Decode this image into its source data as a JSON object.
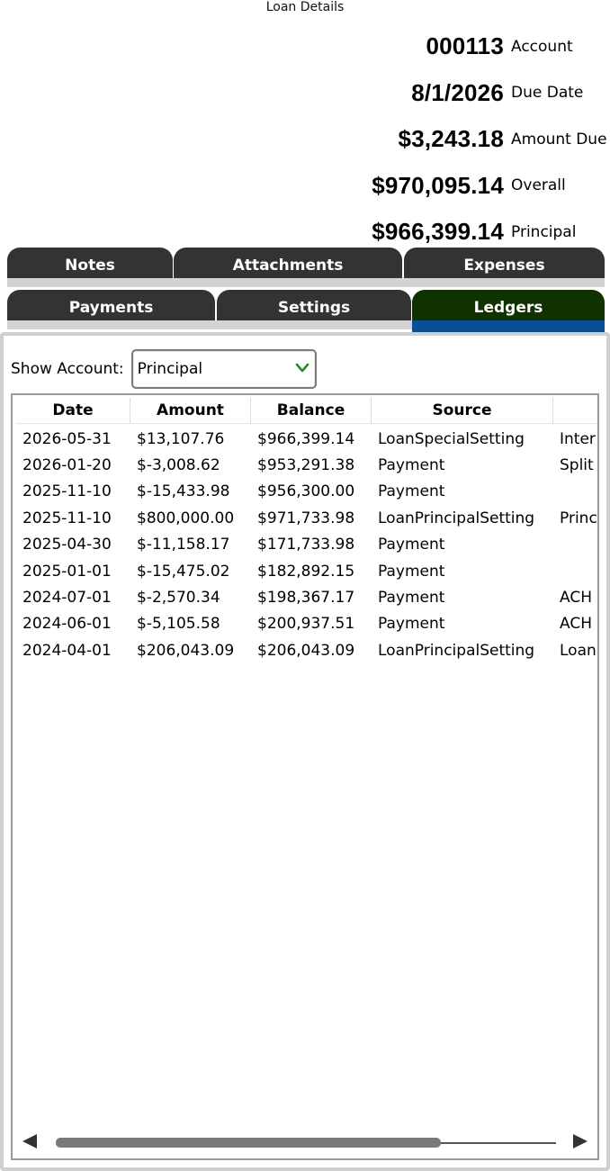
{
  "window": {
    "title": "Loan Details"
  },
  "summary": [
    {
      "value": "000113",
      "label": "Account"
    },
    {
      "value": "8/1/2026",
      "label": "Due Date"
    },
    {
      "value": "$3,243.18",
      "label": "Amount Due"
    },
    {
      "value": "$970,095.14",
      "label": "Overall"
    },
    {
      "value": "$966,399.14",
      "label": "Principal"
    }
  ],
  "tabs_top": [
    "Notes",
    "Attachments",
    "Expenses"
  ],
  "tabs_bottom": [
    "Payments",
    "Settings",
    "Ledgers"
  ],
  "active_tab": "Ledgers",
  "filter": {
    "label": "Show Account:",
    "selected": "Principal"
  },
  "table": {
    "columns": [
      "Date",
      "Amount",
      "Balance",
      "Source",
      ""
    ],
    "rows": [
      [
        "2026-05-31",
        "$13,107.76",
        "$966,399.14",
        "LoanSpecialSetting",
        "Inter"
      ],
      [
        "2026-01-20",
        "$-3,008.62",
        "$953,291.38",
        "Payment",
        "Split"
      ],
      [
        "2025-11-10",
        "$-15,433.98",
        "$956,300.00",
        "Payment",
        ""
      ],
      [
        "2025-11-10",
        "$800,000.00",
        "$971,733.98",
        "LoanPrincipalSetting",
        "Princ"
      ],
      [
        "2025-04-30",
        "$-11,158.17",
        "$171,733.98",
        "Payment",
        ""
      ],
      [
        "2025-01-01",
        "$-15,475.02",
        "$182,892.15",
        "Payment",
        ""
      ],
      [
        "2024-07-01",
        "$-2,570.34",
        "$198,367.17",
        "Payment",
        "ACH"
      ],
      [
        "2024-06-01",
        "$-5,105.58",
        "$200,937.51",
        "Payment",
        "ACH"
      ],
      [
        "2024-04-01",
        "$206,043.09",
        "$206,043.09",
        "LoanPrincipalSetting",
        "Loan"
      ]
    ]
  },
  "colors": {
    "tab_bg": "#333333",
    "tab_active_bg": "#0f3200",
    "tab_active_indicator": "#0a4f96",
    "dropdown_chevron": "#2a8a2a"
  },
  "icons": {
    "dropdown": "chevron-down-icon",
    "scroll_left": "arrow-left-icon",
    "scroll_right": "arrow-right-icon"
  }
}
